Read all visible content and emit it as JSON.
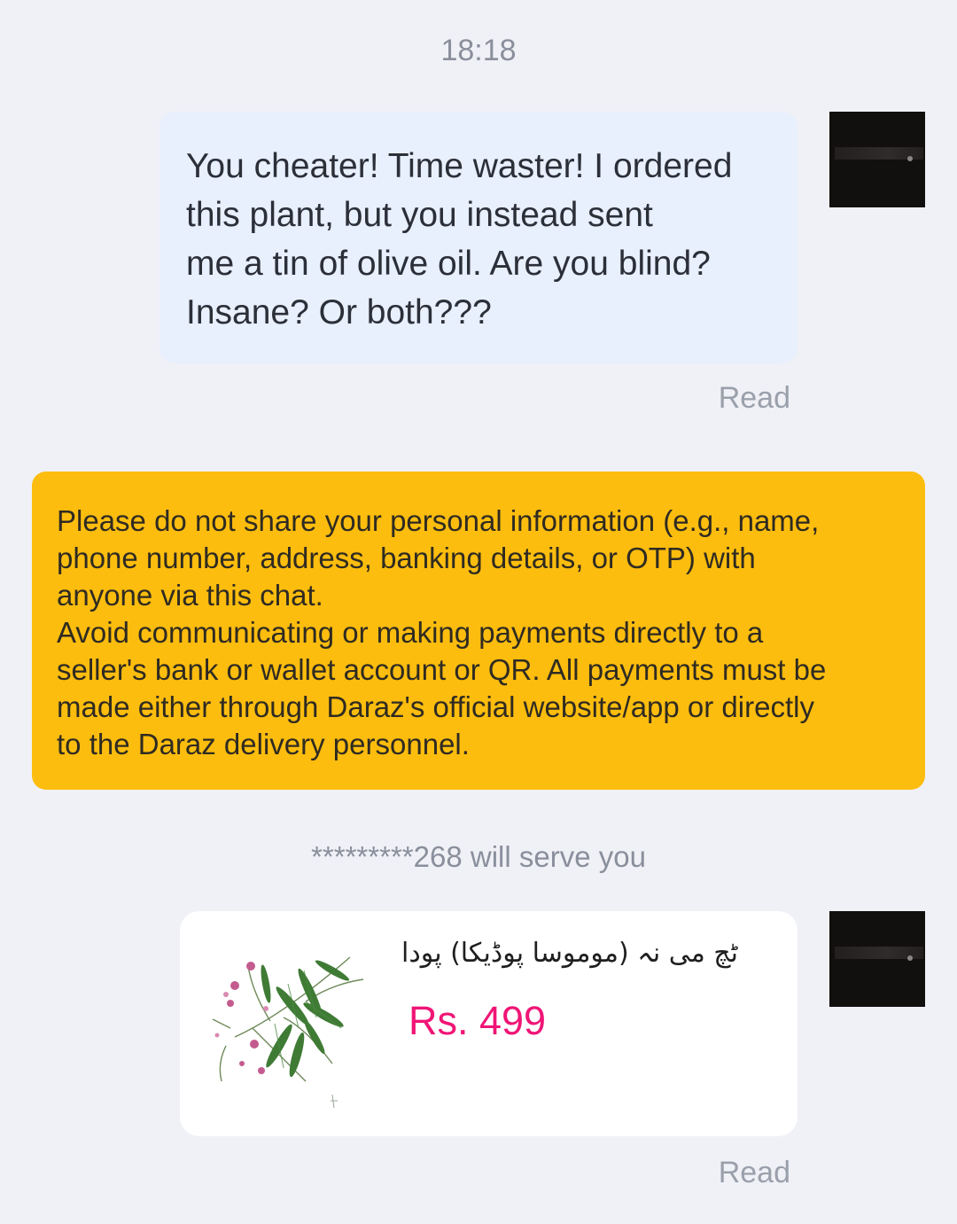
{
  "chat": {
    "timestamp": "18:18",
    "messages": [
      {
        "lines": [
          "You cheater! Time waster! I ordered",
          "this plant, but you instead sent",
          "me a tin of olive oil. Are you blind?",
          "Insane? Or both???"
        ],
        "status": "Read"
      }
    ],
    "notice": {
      "lines": [
        "Please do not share your personal information (e.g., name,",
        "phone number, address, banking details, or OTP) with",
        "anyone via this chat.",
        "Avoid communicating or making payments directly to a",
        "seller's bank or wallet account or QR. All payments must be",
        "made either through Daraz's official website/app or directly",
        "to the Daraz delivery personnel."
      ],
      "background": "#fdbd0e"
    },
    "serve_notice": "*********268 will serve you",
    "product": {
      "title": "ٹچ می نہ (مومو‌سا پوڈیکا) پودا",
      "price": "Rs. 499",
      "price_color": "#f01576",
      "image": "mimosa-plant-image",
      "status": "Read"
    },
    "avatar_icon": "user-avatar"
  }
}
